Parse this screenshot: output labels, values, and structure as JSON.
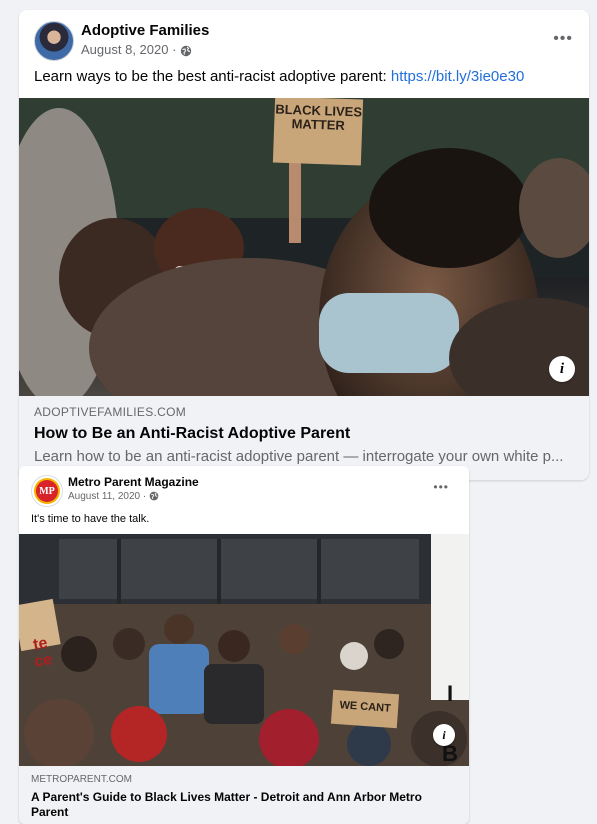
{
  "posts": [
    {
      "page_name": "Adoptive Families",
      "date": "August 8, 2020 · ",
      "audience_icon": "globe-icon",
      "more_icon": "•••",
      "text": "Learn ways to be the best anti-racist adoptive parent: ",
      "link_url_text": "https://bit.ly/3ie0e30",
      "image_sign_text": "BLACK LIVES MATTER",
      "info_icon": "i",
      "link_domain": "ADOPTIVEFAMILIES.COM",
      "link_title": "How to Be an Anti-Racist Adoptive Parent",
      "link_description": "Learn how to be an anti-racist adoptive parent — interrogate your own white p..."
    },
    {
      "page_name": "Metro Parent Magazine",
      "avatar_text": "MP",
      "date": "August 11, 2020 · ",
      "audience_icon": "globe-icon",
      "more_icon": "•••",
      "text": "It's time to have the talk.",
      "image_sign_left": "te\nce",
      "image_sign_right": "I\nB",
      "image_sign_center": "WE CANT",
      "info_icon": "i",
      "link_domain": "METROPARENT.COM",
      "link_title": "A Parent's Guide to Black Lives Matter - Detroit and Ann Arbor Metro Parent"
    }
  ],
  "colors": {
    "link": "#216fdb",
    "secondary_text": "#65676b",
    "meta_bg": "#f0f2f5"
  }
}
